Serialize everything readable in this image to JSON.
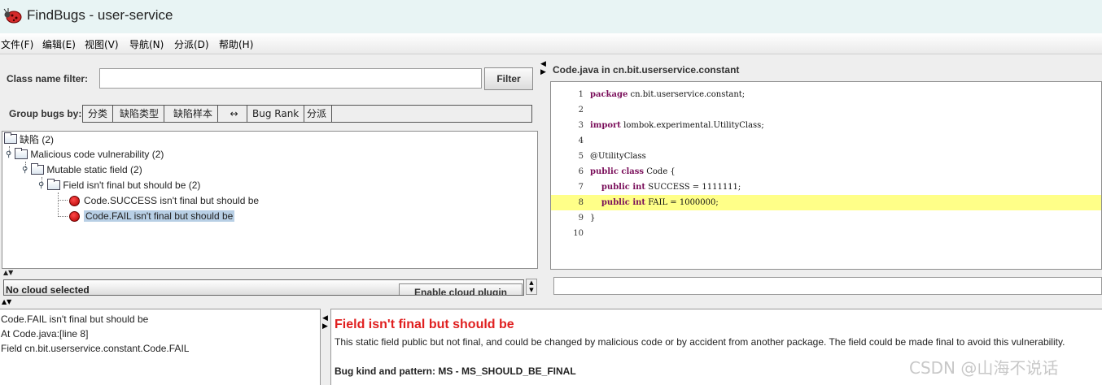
{
  "window": {
    "title": "FindBugs - user-service",
    "logo_icon": "ladybug-icon"
  },
  "menu": [
    "文件(F)",
    "编辑(E)",
    "视图(V)",
    "导航(N)",
    "分派(D)",
    "帮助(H)"
  ],
  "filter": {
    "label": "Class name filter:",
    "value": "",
    "button_label": "Filter"
  },
  "group_by": {
    "label": "Group bugs by:",
    "items": [
      "分类",
      "缺陷类型",
      "缺陷样本",
      "↔",
      "Bug Rank",
      "分派"
    ]
  },
  "tree": {
    "root": "缺陷 (2)",
    "category": "Malicious code vulnerability (2)",
    "subcategory": "Mutable static field (2)",
    "pattern": "Field isn't final but should be (2)",
    "bugs": [
      "Code.SUCCESS isn't final but should be",
      "Code.FAIL isn't final but should be"
    ],
    "selected_index": 1
  },
  "cloud": {
    "status": "No cloud selected",
    "button_label": "Enable cloud plugin"
  },
  "source": {
    "header": "Code.java in cn.bit.userservice.constant",
    "highlight_line": 8,
    "lines": [
      {
        "n": "1",
        "kw": "package",
        "text": " cn.bit.userservice.constant;"
      },
      {
        "n": "2",
        "kw": "",
        "text": ""
      },
      {
        "n": "3",
        "kw": "import",
        "text": " lombok.experimental.UtilityClass;"
      },
      {
        "n": "4",
        "kw": "",
        "text": ""
      },
      {
        "n": "5",
        "kw": "",
        "text": "@UtilityClass"
      },
      {
        "n": "6",
        "kw": "public class",
        "text": " Code {"
      },
      {
        "n": "7",
        "kw": "    public int",
        "text": " SUCCESS = 1111111;"
      },
      {
        "n": "8",
        "kw": "    public int",
        "text": " FAIL = 1000000;"
      },
      {
        "n": "9",
        "kw": "",
        "text": "}"
      },
      {
        "n": "10",
        "kw": "",
        "text": ""
      }
    ]
  },
  "summary": [
    "Code.FAIL isn't final but should be",
    "At Code.java:[line 8]",
    "Field cn.bit.userservice.constant.Code.FAIL"
  ],
  "details": {
    "title": "Field isn't final but should be",
    "description": "This static field public but not final, and could be changed by malicious code or by accident from another package. The field could be made final to avoid this vulnerability.",
    "pattern": "Bug kind and pattern: MS - MS_SHOULD_BE_FINAL"
  },
  "watermark": "CSDN @山海不说话"
}
